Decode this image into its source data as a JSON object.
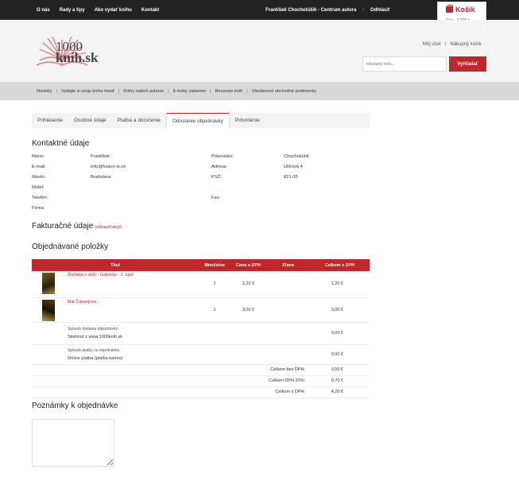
{
  "topnav": [
    "O nás",
    "Rady a tipy",
    "Ako vydať knihu",
    "Kontakt"
  ],
  "account": {
    "user": "František Chocholúšik - Centrum autora",
    "logout": "Odhlásiť"
  },
  "cart": {
    "title": "Košík",
    "summary": "2 ks - 4,20€"
  },
  "logo": {
    "number": "1000",
    "name": "kníh.sk"
  },
  "userlinks": {
    "account": "Môj účet",
    "sep": "/",
    "cart": "Nákupný košík"
  },
  "search": {
    "placeholder": "Hľadaný text...",
    "button": "Vyhľadať"
  },
  "catnav": [
    "Novinky",
    "Vydajte si svoju knihu hneď",
    "Knihy našich autorov",
    "E-knihy zadarmo",
    "Recenzie kníh",
    "Všeobecné obchodné podmienky"
  ],
  "steps": [
    "Prihlásenie",
    "Osobné údaje",
    "Platba a doručenie",
    "Odoslanie objednávky",
    "Potvrdenie"
  ],
  "contact": {
    "heading": "Kontaktné údaje",
    "rows": [
      [
        "Meno:",
        "František",
        "Priezvisko:",
        "Chocholúšik"
      ],
      [
        "E-mail:",
        "info@fusion-is.sk",
        "Adresa:",
        "Uličová 4"
      ],
      [
        "Mesto:",
        "Bratislava",
        "PSČ:",
        "821 05"
      ],
      [
        "Mobil:",
        "",
        "",
        ""
      ],
      [
        "Telefón:",
        "",
        "Fax:",
        ""
      ],
      [
        "Firma:",
        "",
        "",
        ""
      ]
    ]
  },
  "billing": {
    "heading": "Fakturačné údaje",
    "toggle": "(zobraziť/skryť)"
  },
  "order": {
    "heading": "Objednávané položky",
    "columns": [
      "Titul",
      "Množstvo",
      "Cena s DPH",
      "Zľava",
      "Celkom s DPH"
    ],
    "items": [
      {
        "title": "Zločinka v duši - Gabriela - 2. časť",
        "qty": "1",
        "price": "1,20 €",
        "discount": "",
        "total": "1,20 €"
      },
      {
        "title": "Mat Čakanjova",
        "qty": "1",
        "price": "3,00 €",
        "discount": "",
        "total": "3,00 €"
      }
    ],
    "delivery_label": "Spôsob dodania objednávky:",
    "delivery_value": "Stiahnuť z www.1000knih.sk",
    "delivery_price": "0,00 €",
    "payment_label": "Spôsob platby za objednávku:",
    "payment_value": "Online platba (platba kartou)",
    "payment_price": "0,00 €",
    "summary": [
      [
        "Celkom bez DPH:",
        "3,50 €"
      ],
      [
        "Celkom DPH 20%:",
        "0,70 €"
      ],
      [
        "Celkom s DPH:",
        "4,20 €"
      ]
    ]
  },
  "notes": {
    "heading": "Poznámky k objednávke"
  }
}
